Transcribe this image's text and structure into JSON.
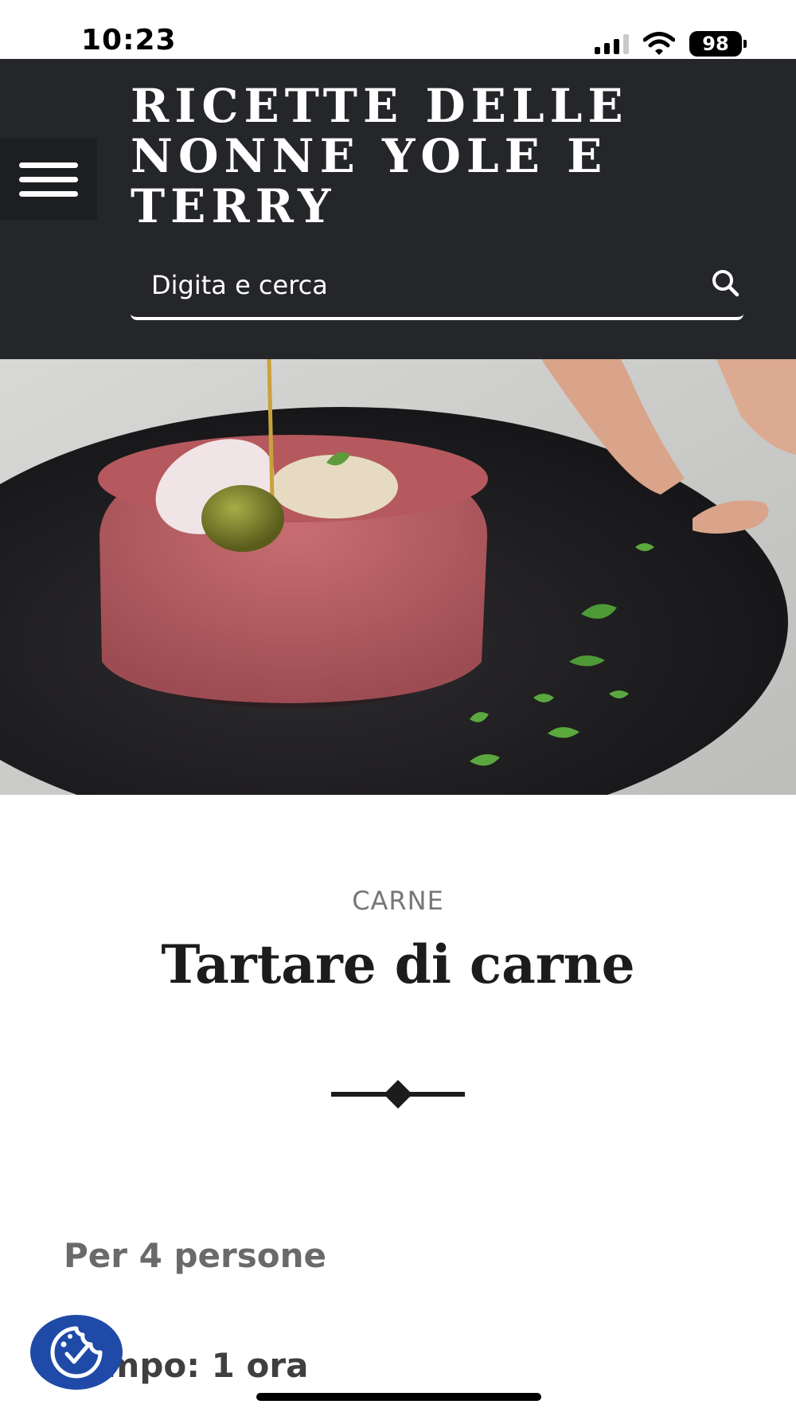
{
  "status_bar": {
    "time": "10:23",
    "battery": "98",
    "signal_strength": "3 of 4 bars"
  },
  "header": {
    "site_title": "RICETTE DELLE NONNE YOLE E TERRY",
    "menu_icon": "hamburger-menu-icon",
    "search": {
      "placeholder": "Digita e cerca",
      "icon": "search-icon"
    }
  },
  "hero": {
    "icon": "tartare-photo"
  },
  "recipe": {
    "category": "CARNE",
    "title": "Tartare di carne",
    "servings": "Per 4 persone",
    "time": "Tempo: 1 ora"
  },
  "cookie_consent": {
    "icon": "cookie-consent-icon"
  },
  "colors": {
    "header_bg": "#25262a",
    "accent_blue": "#1f4aa8",
    "text_dark": "#1c1c1e",
    "text_gray": "#77777a"
  }
}
